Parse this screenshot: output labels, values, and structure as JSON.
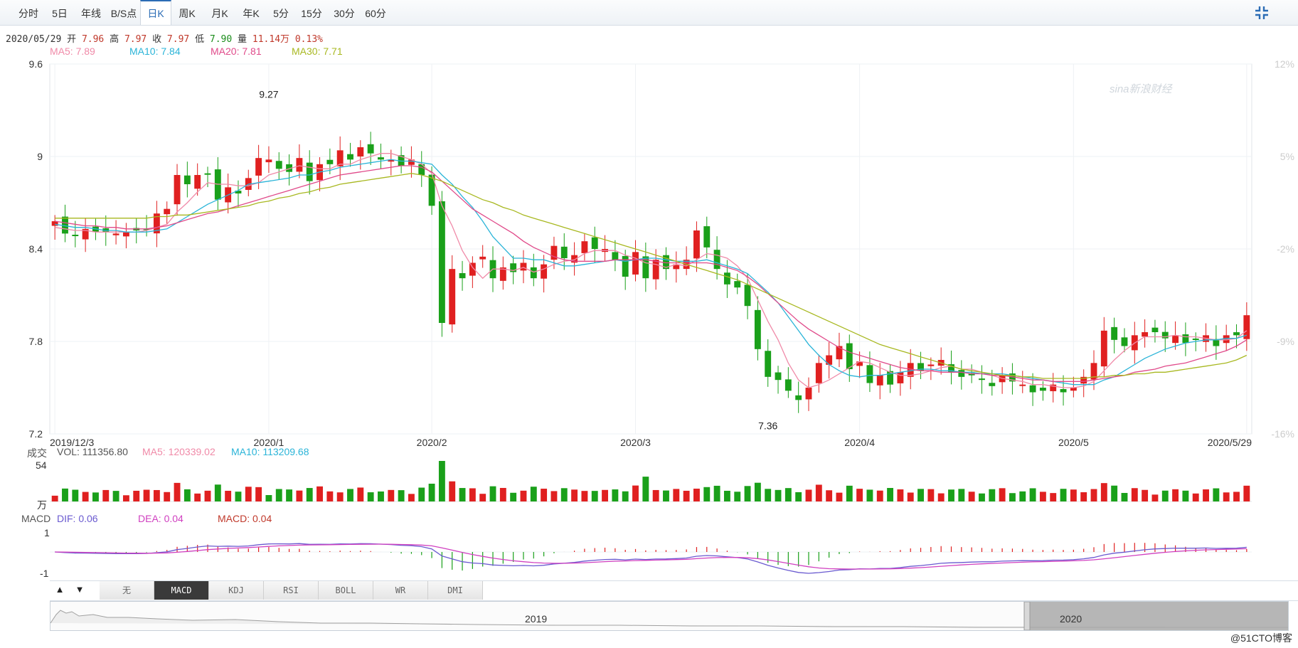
{
  "toolbar": {
    "tabs": [
      {
        "label": "分时",
        "active": false
      },
      {
        "label": "5日",
        "active": false
      },
      {
        "label": "年线",
        "active": false
      },
      {
        "label": "B/S点",
        "active": false
      },
      {
        "label": "日K",
        "active": true
      },
      {
        "label": "周K",
        "active": false
      },
      {
        "label": "月K",
        "active": false
      },
      {
        "label": "年K",
        "active": false
      },
      {
        "label": "5分",
        "active": false
      },
      {
        "label": "15分",
        "active": false
      },
      {
        "label": "30分",
        "active": false
      },
      {
        "label": "60分",
        "active": false
      }
    ]
  },
  "quote": {
    "date": "2020/05/29",
    "open_label": "开",
    "open": "7.96",
    "high_label": "高",
    "high": "7.97",
    "close_label": "收",
    "close": "7.97",
    "low_label": "低",
    "low": "7.90",
    "vol_label": "量",
    "volume": "11.14万",
    "change": "0.13%"
  },
  "ma": {
    "ma5": "MA5: 7.89",
    "ma10": "MA10: 7.84",
    "ma20": "MA20: 7.81",
    "ma30": "MA30: 7.71"
  },
  "volume_panel": {
    "title": "成交",
    "vol": "VOL: 111356.80",
    "ma5": "MA5: 120339.02",
    "ma10": "MA10: 113209.68",
    "y_top": "54",
    "y_unit": "万"
  },
  "macd_panel": {
    "title": "MACD",
    "dif": "DIF: 0.06",
    "dea": "DEA: 0.04",
    "macd": "MACD: 0.04",
    "y_top": "1",
    "y_bottom": "-1"
  },
  "indicator_tabs": [
    "无",
    "MACD",
    "KDJ",
    "RSI",
    "BOLL",
    "WR",
    "DMI"
  ],
  "active_indicator": "MACD",
  "navigator": {
    "year1": "2019",
    "year2": "2020"
  },
  "watermark": "sina新浪财经",
  "credit": "@51CTO博客",
  "colors": {
    "up": "#e02020",
    "down": "#1aa01a",
    "ma5": "#f08aa8",
    "ma10": "#2ab4d8",
    "ma20": "#e04a8a",
    "ma30": "#a8b820"
  },
  "chart_data": {
    "type": "candlestick",
    "y_axis": {
      "ylim": [
        7.2,
        9.6
      ],
      "ticks": [
        "9.6",
        "9",
        "8.4",
        "7.8",
        "7.2"
      ]
    },
    "y_axis_right_ticks": [
      "12%",
      "5%",
      "-2%",
      "-9%",
      "-16%"
    ],
    "x_labels": [
      {
        "label": "2019/12/3",
        "index": 0
      },
      {
        "label": "2020/1",
        "index": 21
      },
      {
        "label": "2020/2",
        "index": 37
      },
      {
        "label": "2020/3",
        "index": 57
      },
      {
        "label": "2020/4",
        "index": 79
      },
      {
        "label": "2020/5",
        "index": 100
      },
      {
        "label": "2020/5/29",
        "index": 117
      }
    ],
    "annotations": [
      {
        "text": "9.27",
        "index": 21,
        "value": 9.27
      },
      {
        "text": "7.36",
        "index": 70,
        "value": 7.36
      }
    ],
    "closes": [
      8.58,
      8.5,
      8.49,
      8.53,
      8.51,
      8.51,
      8.5,
      8.51,
      8.52,
      8.53,
      8.63,
      8.66,
      8.88,
      8.82,
      8.88,
      8.89,
      8.72,
      8.8,
      8.76,
      8.86,
      8.99,
      8.98,
      8.92,
      8.9,
      8.99,
      8.84,
      8.95,
      8.95,
      9.04,
      8.98,
      9.06,
      9.02,
      8.98,
      8.98,
      8.94,
      8.98,
      8.88,
      8.68,
      7.92,
      8.27,
      8.21,
      8.31,
      8.35,
      8.21,
      8.28,
      8.25,
      8.31,
      8.21,
      8.3,
      8.42,
      8.34,
      8.36,
      8.45,
      8.4,
      8.4,
      8.33,
      8.22,
      8.38,
      8.21,
      8.33,
      8.27,
      8.3,
      8.33,
      8.52,
      8.41,
      8.27,
      8.17,
      8.15,
      8.03,
      7.75,
      7.57,
      7.55,
      7.48,
      7.42,
      7.5,
      7.66,
      7.71,
      7.77,
      7.62,
      7.67,
      7.53,
      7.58,
      7.52,
      7.6,
      7.66,
      7.61,
      7.65,
      7.68,
      7.6,
      7.57,
      7.58,
      7.55,
      7.51,
      7.58,
      7.54,
      7.52,
      7.47,
      7.48,
      7.52,
      7.47,
      7.5,
      7.57,
      7.66,
      7.87,
      7.81,
      7.77,
      7.84,
      7.86,
      7.86,
      7.82,
      7.84,
      7.79,
      7.81,
      7.84,
      7.77,
      7.84,
      7.84,
      7.97
    ],
    "ma5": [
      8.54,
      8.53,
      8.52,
      8.52,
      8.51,
      8.51,
      8.51,
      8.51,
      8.51,
      8.52,
      8.54,
      8.56,
      8.64,
      8.7,
      8.77,
      8.83,
      8.82,
      8.82,
      8.81,
      8.81,
      8.83,
      8.88,
      8.9,
      8.92,
      8.94,
      8.93,
      8.92,
      8.92,
      8.95,
      8.95,
      8.98,
      9.0,
      9.02,
      9.02,
      9.0,
      8.98,
      8.95,
      8.89,
      8.68,
      8.55,
      8.39,
      8.28,
      8.21,
      8.27,
      8.27,
      8.26,
      8.28,
      8.25,
      8.27,
      8.3,
      8.32,
      8.33,
      8.37,
      8.39,
      8.39,
      8.39,
      8.36,
      8.34,
      8.31,
      8.3,
      8.28,
      8.3,
      8.29,
      8.33,
      8.37,
      8.36,
      8.34,
      8.29,
      8.21,
      8.07,
      7.93,
      7.81,
      7.66,
      7.55,
      7.5,
      7.52,
      7.55,
      7.59,
      7.63,
      7.67,
      7.66,
      7.63,
      7.6,
      7.58,
      7.58,
      7.59,
      7.61,
      7.63,
      7.64,
      7.62,
      7.62,
      7.6,
      7.58,
      7.56,
      7.55,
      7.54,
      7.52,
      7.52,
      7.51,
      7.5,
      7.5,
      7.51,
      7.54,
      7.61,
      7.68,
      7.74,
      7.79,
      7.83,
      7.83,
      7.83,
      7.84,
      7.83,
      7.83,
      7.82,
      7.81,
      7.81,
      7.82,
      7.87
    ],
    "ma10": [
      8.56,
      8.55,
      8.54,
      8.54,
      8.53,
      8.52,
      8.52,
      8.51,
      8.51,
      8.51,
      8.52,
      8.53,
      8.57,
      8.61,
      8.65,
      8.69,
      8.72,
      8.75,
      8.78,
      8.82,
      8.83,
      8.84,
      8.85,
      8.86,
      8.88,
      8.88,
      8.9,
      8.91,
      8.93,
      8.94,
      8.95,
      8.96,
      8.97,
      8.98,
      8.97,
      8.97,
      8.96,
      8.95,
      8.88,
      8.82,
      8.74,
      8.67,
      8.58,
      8.48,
      8.41,
      8.34,
      8.34,
      8.33,
      8.33,
      8.31,
      8.29,
      8.29,
      8.3,
      8.31,
      8.32,
      8.33,
      8.32,
      8.33,
      8.34,
      8.34,
      8.33,
      8.32,
      8.32,
      8.32,
      8.33,
      8.31,
      8.29,
      8.27,
      8.24,
      8.18,
      8.12,
      8.05,
      7.96,
      7.87,
      7.78,
      7.71,
      7.65,
      7.61,
      7.58,
      7.57,
      7.58,
      7.58,
      7.59,
      7.6,
      7.61,
      7.62,
      7.62,
      7.61,
      7.61,
      7.6,
      7.6,
      7.59,
      7.59,
      7.59,
      7.58,
      7.57,
      7.56,
      7.55,
      7.54,
      7.53,
      7.52,
      7.52,
      7.52,
      7.55,
      7.57,
      7.61,
      7.65,
      7.69,
      7.72,
      7.75,
      7.77,
      7.79,
      7.8,
      7.81,
      7.81,
      7.82,
      7.82,
      7.84
    ],
    "ma20": [
      8.58,
      8.57,
      8.56,
      8.55,
      8.55,
      8.54,
      8.54,
      8.53,
      8.53,
      8.53,
      8.54,
      8.55,
      8.57,
      8.59,
      8.61,
      8.63,
      8.64,
      8.66,
      8.68,
      8.7,
      8.72,
      8.74,
      8.76,
      8.78,
      8.8,
      8.82,
      8.84,
      8.86,
      8.88,
      8.89,
      8.9,
      8.91,
      8.92,
      8.93,
      8.94,
      8.94,
      8.93,
      8.9,
      8.84,
      8.78,
      8.72,
      8.66,
      8.62,
      8.58,
      8.54,
      8.5,
      8.45,
      8.41,
      8.38,
      8.35,
      8.33,
      8.32,
      8.32,
      8.32,
      8.32,
      8.33,
      8.33,
      8.33,
      8.33,
      8.32,
      8.31,
      8.31,
      8.31,
      8.31,
      8.31,
      8.3,
      8.28,
      8.26,
      8.22,
      8.17,
      8.11,
      8.05,
      7.99,
      7.93,
      7.88,
      7.84,
      7.8,
      7.76,
      7.73,
      7.71,
      7.69,
      7.67,
      7.65,
      7.63,
      7.62,
      7.61,
      7.61,
      7.6,
      7.6,
      7.6,
      7.59,
      7.59,
      7.58,
      7.58,
      7.57,
      7.56,
      7.55,
      7.55,
      7.54,
      7.54,
      7.54,
      7.54,
      7.55,
      7.56,
      7.57,
      7.58,
      7.6,
      7.61,
      7.62,
      7.64,
      7.65,
      7.66,
      7.68,
      7.7,
      7.72,
      7.74,
      7.77,
      7.81
    ],
    "ma30": [
      8.6,
      8.6,
      8.6,
      8.6,
      8.6,
      8.6,
      8.6,
      8.6,
      8.6,
      8.6,
      8.61,
      8.61,
      8.62,
      8.62,
      8.63,
      8.64,
      8.65,
      8.66,
      8.67,
      8.68,
      8.7,
      8.71,
      8.73,
      8.74,
      8.76,
      8.77,
      8.79,
      8.8,
      8.82,
      8.83,
      8.84,
      8.85,
      8.86,
      8.87,
      8.88,
      8.89,
      8.88,
      8.86,
      8.84,
      8.81,
      8.78,
      8.75,
      8.72,
      8.7,
      8.67,
      8.65,
      8.62,
      8.6,
      8.58,
      8.56,
      8.54,
      8.52,
      8.5,
      8.48,
      8.46,
      8.44,
      8.42,
      8.4,
      8.38,
      8.36,
      8.34,
      8.32,
      8.3,
      8.28,
      8.26,
      8.24,
      8.22,
      8.2,
      8.17,
      8.14,
      8.11,
      8.08,
      8.05,
      8.02,
      7.99,
      7.96,
      7.93,
      7.9,
      7.87,
      7.84,
      7.81,
      7.78,
      7.76,
      7.74,
      7.72,
      7.7,
      7.68,
      7.66,
      7.64,
      7.62,
      7.61,
      7.6,
      7.59,
      7.58,
      7.58,
      7.57,
      7.57,
      7.56,
      7.56,
      7.56,
      7.56,
      7.56,
      7.57,
      7.57,
      7.58,
      7.58,
      7.59,
      7.59,
      7.6,
      7.6,
      7.61,
      7.62,
      7.63,
      7.64,
      7.65,
      7.66,
      7.68,
      7.71
    ]
  }
}
